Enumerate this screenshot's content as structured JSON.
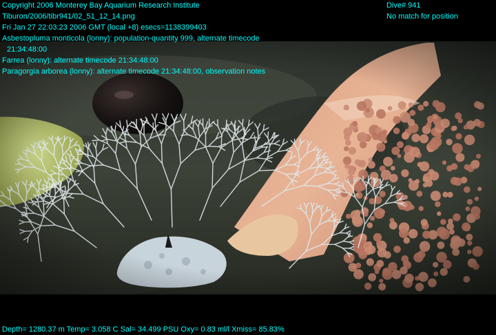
{
  "overlay": {
    "left_lines": [
      "Copyright 2006 Monterey Bay Aquarium Research Institute",
      "Tiburon/2006/tibr941/02_51_12_14.png",
      "Fri Jan 27 22:03:23 2006 GMT (local +8)  esecs=1138399403",
      "Asbestopluma monticola (lonny): population-quantity 999, alternate timecode",
      "21:34:48:00",
      "Farrea (lonny): alternate timecode 21:34:48:00",
      "Paragorgia arborea (lonny): alternate timecode 21:34:48:00, observation notes"
    ],
    "right_lines": [
      "Dive# 941",
      "No match for position"
    ],
    "bottom_line": "Depth= 1280.37 m  Temp= 3.058 C  Sal= 34.499 PSU  Oxy= 0.83 ml/l  Xmiss= 85.83%"
  },
  "colors": {
    "overlay_text": "#00ffff",
    "background": "#000000",
    "seafloor": "#3a4038",
    "sponge_white": "#dfe8ea",
    "coral_orange": "#c98a72",
    "sponge_pink": "#e6ad8c",
    "yellow_sponge": "#b9c46a"
  },
  "scene_elements": [
    "seafloor-rock",
    "pink-vase-sponge",
    "paragorgia-coral",
    "yellow-sponge",
    "dark-sphere",
    "carnivorous-sponge-asbestopluma",
    "farrea-glass-sponge"
  ]
}
